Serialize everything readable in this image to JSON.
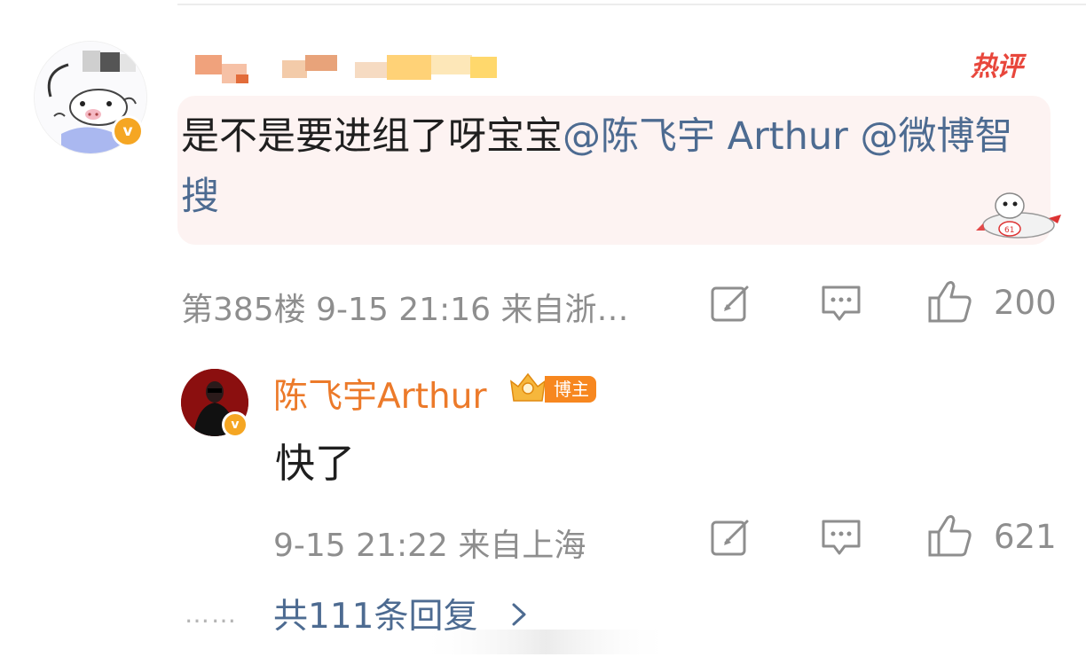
{
  "post": {
    "hot_tag": "热评",
    "content_prefix": "是不是要进组了呀宝宝",
    "mention_1": "@陈飞宇 Arthur",
    "mention_2": "@微博智搜",
    "floor_meta": "第385楼  9-15 21:16  来自浙…",
    "like_count": "200"
  },
  "reply": {
    "author": "陈飞宇Arthur",
    "author_badge": "博主",
    "text": "快了",
    "meta": "9-15 21:22  来自上海",
    "like_count": "621"
  },
  "replies_link": {
    "dots": "……",
    "label": "共111条回复"
  },
  "icons": {
    "avatar_verified": "v-badge",
    "repost": "repost-icon",
    "comment": "comment-icon",
    "like": "thumbs-up-icon",
    "chevron": "chevron-right-icon"
  },
  "colors": {
    "mention": "#4d6b91",
    "author_orange": "#ec7a2a",
    "hot_red": "#e8473c",
    "bubble_bg": "#fdf3f2",
    "meta_gray": "#8e8e8e"
  }
}
